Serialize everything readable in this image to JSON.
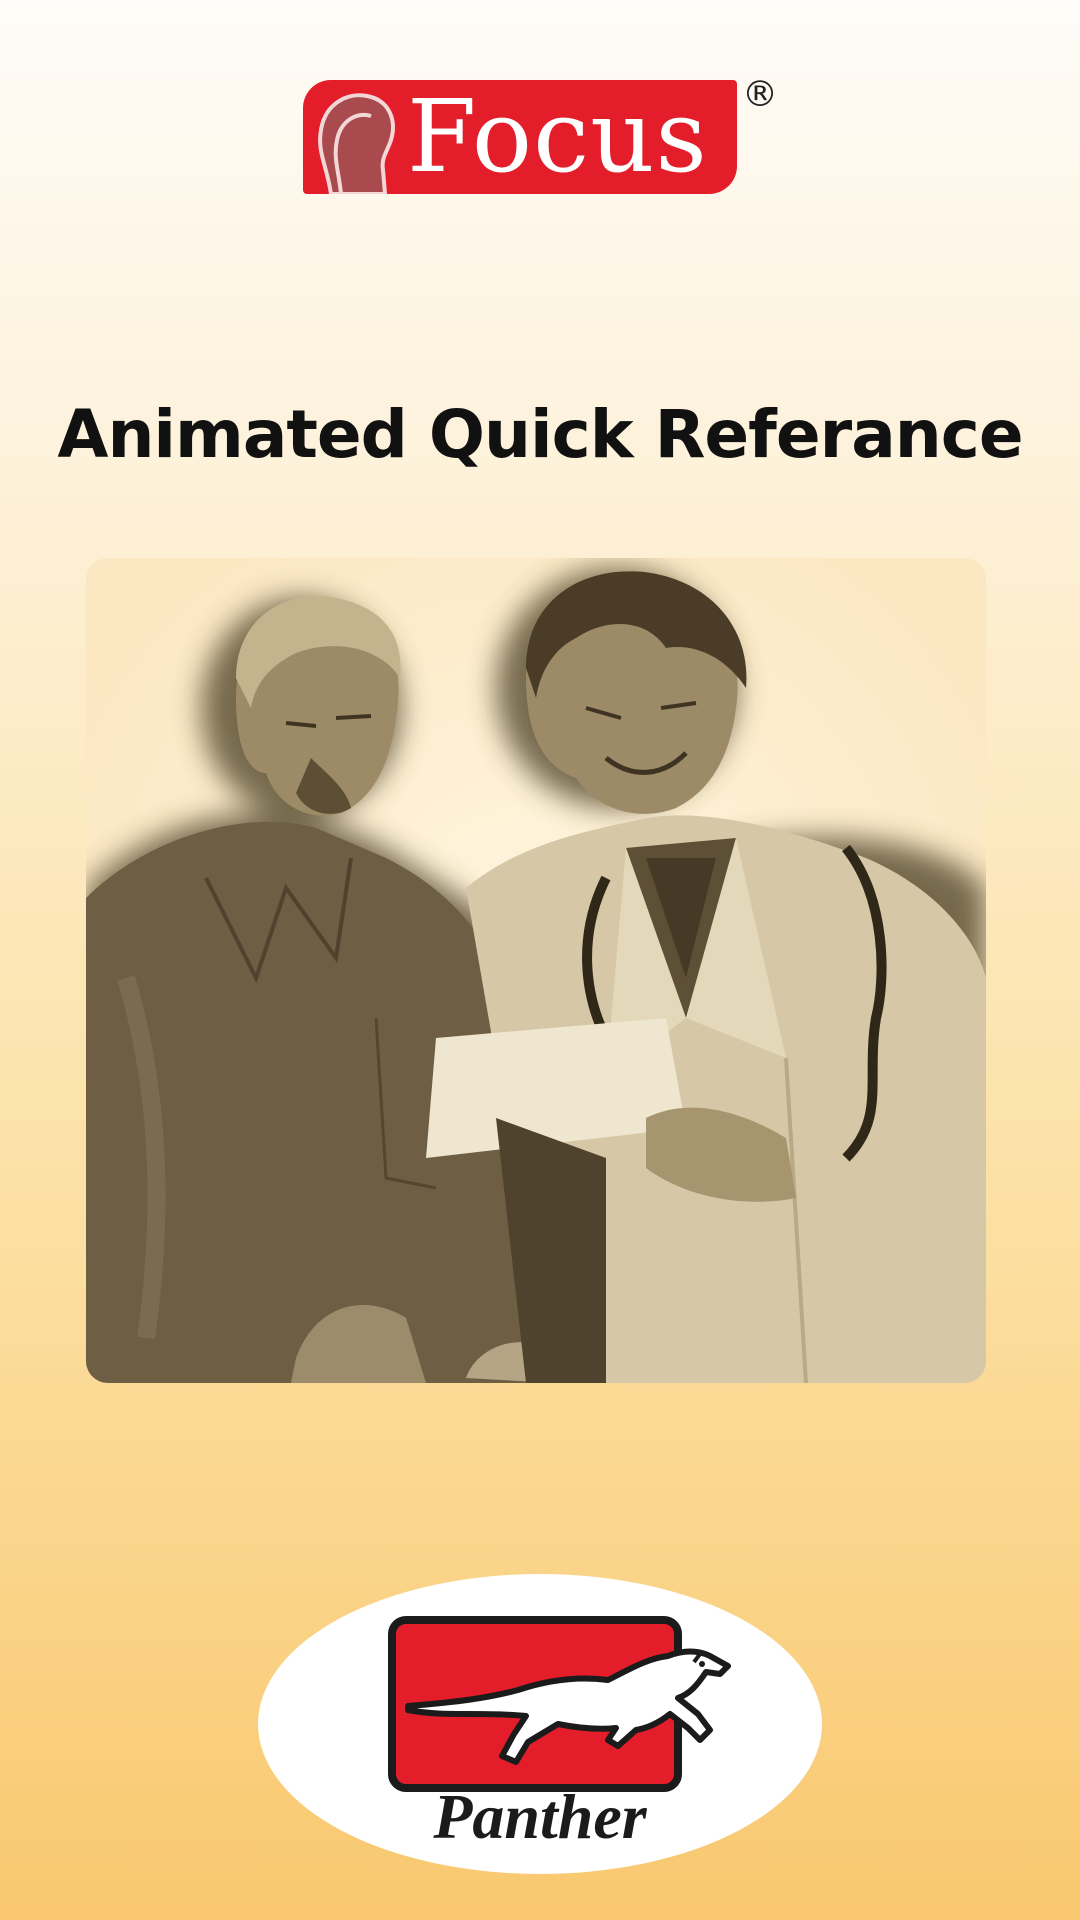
{
  "brand": {
    "name": "Focus",
    "registered_mark": "®"
  },
  "title": "Animated Quick Referance",
  "illustration": {
    "subject": "doctor-and-patient"
  },
  "publisher": {
    "name": "Panther"
  },
  "colors": {
    "brand_red": "#e31e2a",
    "background_top": "#fefcf8",
    "background_bottom": "#f9c86f",
    "sepia_dark": "#5e5037",
    "sepia_light": "#d7c9a8"
  }
}
